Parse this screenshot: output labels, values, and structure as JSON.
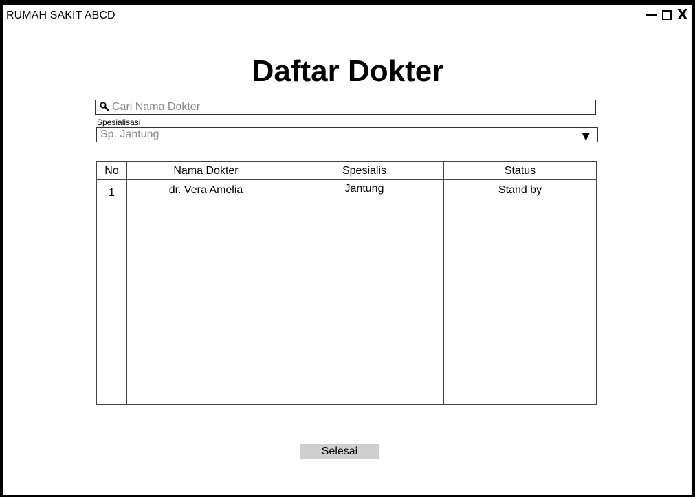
{
  "window": {
    "title": "RUMAH SAKIT ABCD"
  },
  "page": {
    "title": "Daftar Dokter"
  },
  "search": {
    "placeholder": "Cari Nama Dokter",
    "icon": "search-icon"
  },
  "filter": {
    "label": "Spesialisasi",
    "selected": "Sp. Jantung",
    "arrow": "▼"
  },
  "table": {
    "headers": [
      "No",
      "Nama Dokter",
      "Spesialis",
      "Status"
    ],
    "rows": [
      [
        "1",
        "dr. Vera Amelia",
        "Jantung",
        "Stand by"
      ]
    ]
  },
  "actions": {
    "done_label": "Selesai"
  }
}
